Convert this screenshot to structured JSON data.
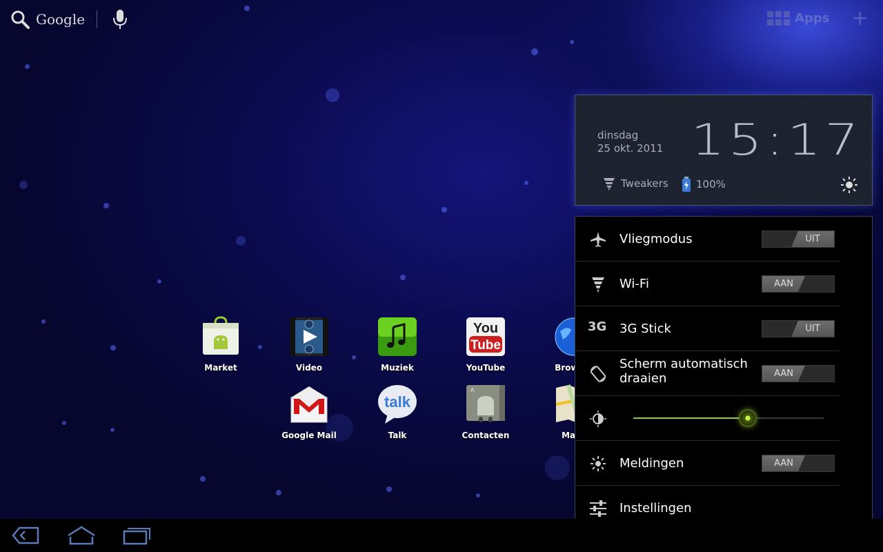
{
  "top": {
    "search_label": "Google",
    "apps_label": "Apps"
  },
  "apps": [
    {
      "label": "Market"
    },
    {
      "label": "Video"
    },
    {
      "label": "Muziek"
    },
    {
      "label": "YouTube"
    },
    {
      "label": "Browser"
    },
    {
      "label": "Google Mail"
    },
    {
      "label": "Talk"
    },
    {
      "label": "Contacten"
    },
    {
      "label": "Maps"
    }
  ],
  "clock": {
    "day": "dinsdag",
    "date": "25 okt. 2011",
    "time": "15:17",
    "network": "Tweakers",
    "battery": "100%"
  },
  "settings": {
    "rows": [
      {
        "label": "Vliegmodus",
        "state": "UIT"
      },
      {
        "label": "Wi-Fi",
        "state": "AAN"
      },
      {
        "label": "3G Stick",
        "state": "UIT",
        "icon_text": "3G"
      },
      {
        "label": "Scherm automatisch draaien",
        "state": "AAN"
      },
      {
        "label": "",
        "brightness": 0.6
      },
      {
        "label": "Meldingen",
        "state": "AAN"
      },
      {
        "label": "Instellingen"
      }
    ]
  },
  "colors": {
    "accent_green": "#9acd32",
    "wallpaper": "#0d0f5a"
  }
}
